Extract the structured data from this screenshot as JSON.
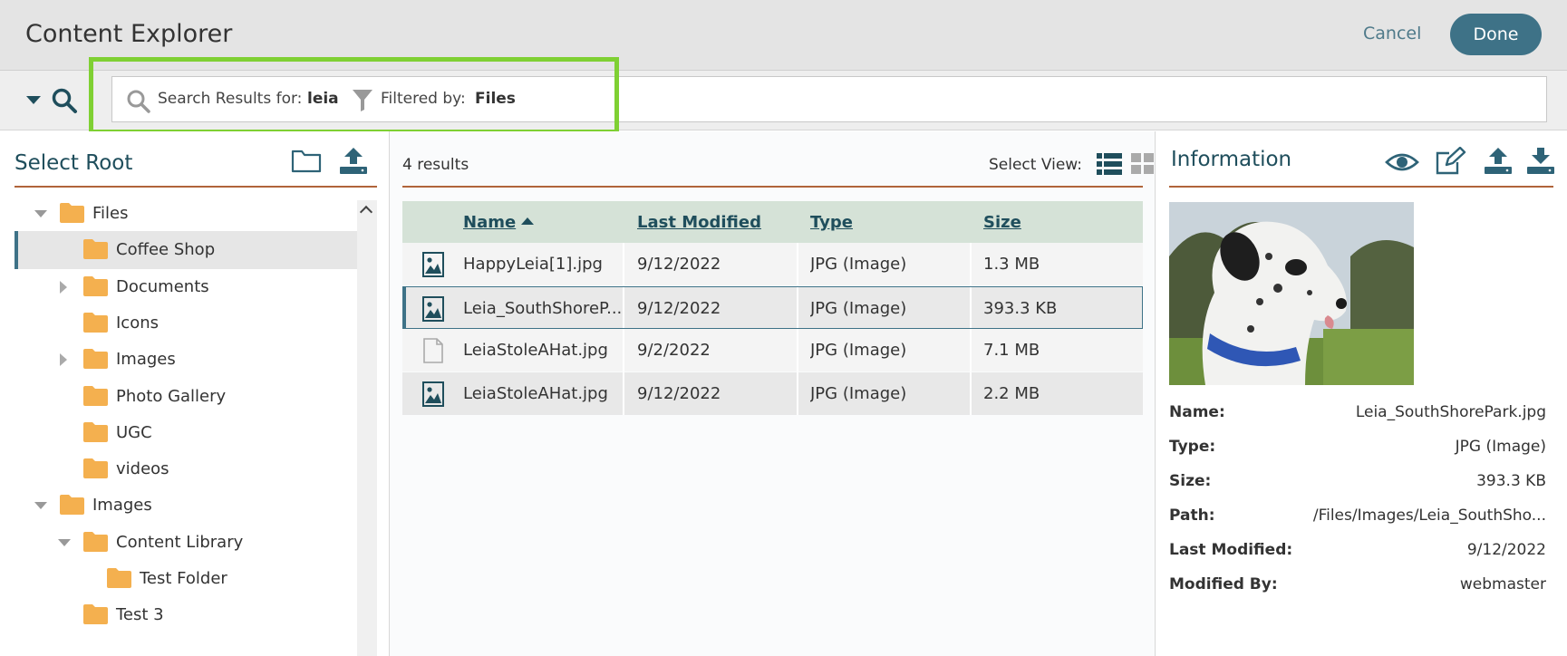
{
  "header": {
    "title": "Content Explorer",
    "cancel_label": "Cancel",
    "done_label": "Done"
  },
  "search": {
    "results_label": "Search Results for:",
    "query": "leia",
    "filter_label": "Filtered by:",
    "filter_value": "Files"
  },
  "left": {
    "title": "Select Root",
    "tree": [
      {
        "label": "Files",
        "depth": 0,
        "toggle": "down",
        "selected": false
      },
      {
        "label": "Coffee Shop",
        "depth": 1,
        "toggle": "none",
        "selected": true
      },
      {
        "label": "Documents",
        "depth": 1,
        "toggle": "right",
        "selected": false
      },
      {
        "label": "Icons",
        "depth": 1,
        "toggle": "none",
        "selected": false
      },
      {
        "label": "Images",
        "depth": 1,
        "toggle": "right",
        "selected": false
      },
      {
        "label": "Photo Gallery",
        "depth": 1,
        "toggle": "none",
        "selected": false
      },
      {
        "label": "UGC",
        "depth": 1,
        "toggle": "none",
        "selected": false
      },
      {
        "label": "videos",
        "depth": 1,
        "toggle": "none",
        "selected": false
      },
      {
        "label": "Images",
        "depth": 0,
        "toggle": "down",
        "selected": false
      },
      {
        "label": "Content Library",
        "depth": 1,
        "toggle": "down",
        "selected": false
      },
      {
        "label": "Test Folder",
        "depth": 2,
        "toggle": "none",
        "selected": false
      },
      {
        "label": "Test 3",
        "depth": 1,
        "toggle": "none",
        "selected": false
      }
    ]
  },
  "middle": {
    "results_count": "4 results",
    "select_view_label": "Select View:",
    "columns": {
      "name": "Name",
      "modified": "Last Modified",
      "type": "Type",
      "size": "Size"
    },
    "rows": [
      {
        "icon": "image-file-icon",
        "name": "HappyLeia[1].jpg",
        "modified": "9/12/2022",
        "type": "JPG (Image)",
        "size": "1.3 MB",
        "selected": false
      },
      {
        "icon": "image-file-icon",
        "name": "Leia_SouthShoreP...",
        "modified": "9/12/2022",
        "type": "JPG (Image)",
        "size": "393.3 KB",
        "selected": true
      },
      {
        "icon": "blank-file-icon",
        "name": "LeiaStoleAHat.jpg",
        "modified": "9/2/2022",
        "type": "JPG (Image)",
        "size": "7.1 MB",
        "selected": false
      },
      {
        "icon": "image-file-icon",
        "name": "LeiaStoleAHat.jpg",
        "modified": "9/12/2022",
        "type": "JPG (Image)",
        "size": "2.2 MB",
        "selected": false
      }
    ]
  },
  "right": {
    "title": "Information",
    "details": [
      {
        "key": "Name:",
        "value": "Leia_SouthShorePark.jpg"
      },
      {
        "key": "Type:",
        "value": "JPG (Image)"
      },
      {
        "key": "Size:",
        "value": "393.3 KB"
      },
      {
        "key": "Path:",
        "value": "/Files/Images/Leia_SouthSho..."
      },
      {
        "key": "Last Modified:",
        "value": "9/12/2022"
      },
      {
        "key": "Modified By:",
        "value": "webmaster"
      }
    ]
  },
  "colors": {
    "accent": "#3e7287",
    "divider": "#b0643a",
    "folder": "#f4b04f",
    "highlight": "#7fd033",
    "grid_header": "#d5e2d7"
  }
}
